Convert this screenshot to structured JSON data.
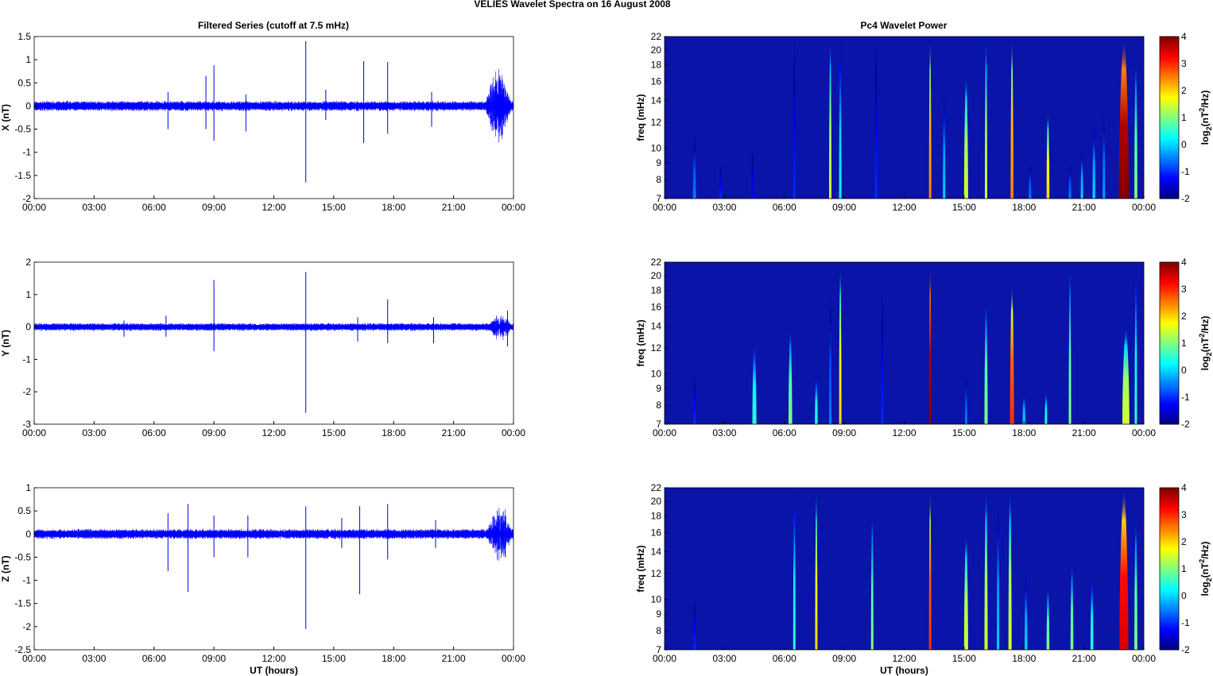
{
  "chart_data": {
    "title": "VELIES Wavelet Spectra on 16 August    2008",
    "left_title": "Filtered Series (cutoff at 7.5 mHz)",
    "right_title": "Pc4 Wavelet Power",
    "xlabel": "UT (hours)",
    "x_ticks": [
      "00:00",
      "03:00",
      "06:00",
      "09:00",
      "12:00",
      "15:00",
      "18:00",
      "21:00",
      "00:00"
    ],
    "xlim": [
      0,
      24
    ],
    "colors": {
      "series": "#0000ff",
      "background": "#0a14a8"
    },
    "series_panels": [
      {
        "type": "line",
        "ylabel": "X (nT)",
        "ylim": [
          -2,
          1.5
        ],
        "y_ticks": [
          "-2",
          "-1.5",
          "-1",
          "-0.5",
          "0",
          "0.5",
          "1",
          "1.5"
        ],
        "noise": 0.09,
        "spikes": [
          [
            6.7,
            0.3,
            -0.5
          ],
          [
            8.6,
            0.65,
            -0.5
          ],
          [
            9.0,
            0.88,
            -0.75
          ],
          [
            10.6,
            0.25,
            -0.55
          ],
          [
            13.6,
            1.4,
            -1.65
          ],
          [
            14.6,
            0.35,
            -0.3
          ],
          [
            16.5,
            0.97,
            -0.8
          ],
          [
            17.7,
            0.95,
            -0.6
          ],
          [
            19.9,
            0.3,
            -0.45
          ]
        ],
        "burst": [
          22.6,
          23.9,
          0.75
        ]
      },
      {
        "type": "line",
        "ylabel": "Y (nT)",
        "ylim": [
          -3,
          2
        ],
        "y_ticks": [
          "-3",
          "-2",
          "-1",
          "0",
          "1",
          "2"
        ],
        "noise": 0.1,
        "spikes": [
          [
            4.5,
            0.2,
            -0.3
          ],
          [
            6.6,
            0.35,
            -0.3
          ],
          [
            9.0,
            1.45,
            -0.75
          ],
          [
            13.6,
            1.7,
            -2.65
          ],
          [
            16.2,
            0.3,
            -0.45
          ],
          [
            17.7,
            0.85,
            -0.5
          ],
          [
            20.0,
            0.3,
            -0.5
          ],
          [
            23.7,
            0.5,
            -0.6
          ]
        ],
        "burst": [
          22.8,
          23.9,
          0.35
        ]
      },
      {
        "type": "line",
        "ylabel": "Z (nT)",
        "ylim": [
          -2.5,
          1
        ],
        "y_ticks": [
          "-2.5",
          "-2",
          "-1.5",
          "-1",
          "-0.5",
          "0",
          "0.5",
          "1"
        ],
        "noise": 0.09,
        "spikes": [
          [
            6.7,
            0.45,
            -0.8
          ],
          [
            7.7,
            0.65,
            -1.25
          ],
          [
            9.0,
            0.4,
            -0.5
          ],
          [
            10.7,
            0.4,
            -0.5
          ],
          [
            13.6,
            0.6,
            -2.05
          ],
          [
            15.4,
            0.35,
            -0.3
          ],
          [
            16.3,
            0.6,
            -1.3
          ],
          [
            17.7,
            0.65,
            -0.55
          ],
          [
            20.1,
            0.3,
            -0.3
          ]
        ],
        "burst": [
          22.7,
          23.9,
          0.6
        ]
      }
    ],
    "spectra_panels": [
      {
        "type": "heatmap",
        "ylabel": "freq (mHz)",
        "events": [
          [
            1.5,
            11,
            -0.5,
            0.15
          ],
          [
            2.8,
            9,
            -1,
            0.1
          ],
          [
            4.4,
            10,
            -1.2,
            0.1
          ],
          [
            6.5,
            22,
            -1,
            0.06
          ],
          [
            8.3,
            22,
            1.5,
            0.08
          ],
          [
            8.8,
            22,
            0.3,
            0.06
          ],
          [
            10.6,
            22,
            -1,
            0.06
          ],
          [
            13.3,
            22,
            2.5,
            0.08
          ],
          [
            14,
            15,
            0,
            0.12
          ],
          [
            15.1,
            17,
            1.5,
            0.2
          ],
          [
            16.1,
            22,
            1.5,
            0.12
          ],
          [
            17.4,
            22,
            2.5,
            0.14
          ],
          [
            18.3,
            9,
            -0.5,
            0.12
          ],
          [
            19.2,
            13,
            2,
            0.14
          ],
          [
            20.3,
            9,
            -0.5,
            0.12
          ],
          [
            20.9,
            10,
            0,
            0.12
          ],
          [
            21.5,
            12,
            0,
            0.14
          ],
          [
            22,
            13,
            -0.3,
            0.12
          ],
          [
            23,
            22,
            4,
            0.5
          ],
          [
            23.6,
            19,
            1,
            0.15
          ]
        ]
      },
      {
        "type": "heatmap",
        "ylabel": "freq (mHz)",
        "events": [
          [
            1.5,
            10,
            -1,
            0.1
          ],
          [
            4.5,
            13,
            0.5,
            0.2
          ],
          [
            6.3,
            14,
            1,
            0.18
          ],
          [
            7.6,
            10,
            0.5,
            0.14
          ],
          [
            8.3,
            18,
            -0.5,
            0.08
          ],
          [
            8.8,
            22,
            2,
            0.08
          ],
          [
            10.9,
            18,
            -1,
            0.06
          ],
          [
            13.3,
            22,
            4,
            0.1
          ],
          [
            15.1,
            10,
            -0.5,
            0.1
          ],
          [
            16.1,
            17,
            1,
            0.16
          ],
          [
            17.4,
            19,
            3,
            0.2
          ],
          [
            18,
            9,
            0,
            0.14
          ],
          [
            19.1,
            9,
            0.5,
            0.12
          ],
          [
            20.3,
            22,
            1,
            0.1
          ],
          [
            23.1,
            14,
            1.5,
            0.35
          ],
          [
            23.6,
            22,
            0.5,
            0.12
          ]
        ]
      },
      {
        "type": "heatmap",
        "ylabel": "freq (mHz)",
        "events": [
          [
            1.5,
            10,
            -1,
            0.1
          ],
          [
            6.5,
            22,
            0.5,
            0.08
          ],
          [
            7.6,
            22,
            2,
            0.1
          ],
          [
            10.4,
            19,
            1,
            0.1
          ],
          [
            13.3,
            22,
            3,
            0.1
          ],
          [
            15.1,
            16,
            1.5,
            0.2
          ],
          [
            16.1,
            22,
            1.5,
            0.16
          ],
          [
            16.7,
            20,
            0,
            0.12
          ],
          [
            17.3,
            22,
            1.5,
            0.16
          ],
          [
            18.1,
            12,
            0,
            0.14
          ],
          [
            19.2,
            11,
            1,
            0.14
          ],
          [
            20.4,
            13,
            1,
            0.14
          ],
          [
            21.4,
            12,
            0.5,
            0.14
          ],
          [
            23,
            22,
            3.5,
            0.45
          ],
          [
            23.6,
            18,
            1,
            0.15
          ]
        ]
      }
    ],
    "freq_ticks": [
      7,
      8,
      9,
      10,
      12,
      14,
      16,
      18,
      20,
      22
    ],
    "freq_lim": [
      7,
      22
    ],
    "colorbar": {
      "label": "log2(nT2/Hz)",
      "range": [
        -2,
        4
      ],
      "ticks": [
        "-2",
        "-1",
        "0",
        "1",
        "2",
        "3",
        "4"
      ]
    }
  }
}
